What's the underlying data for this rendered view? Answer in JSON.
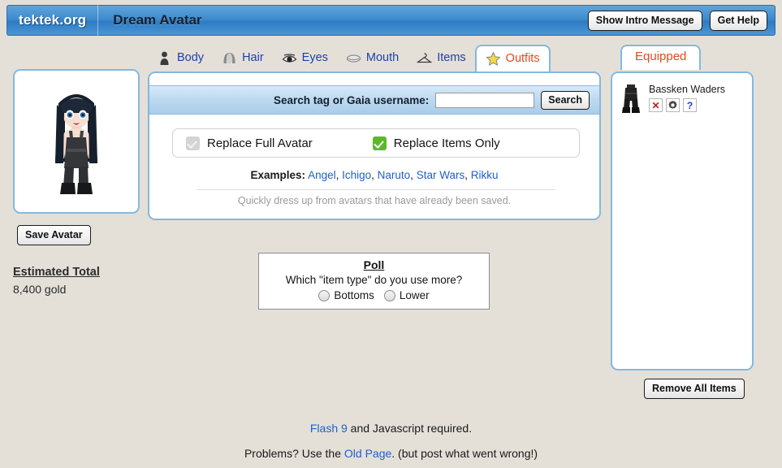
{
  "header": {
    "brand": "tektek.org",
    "title": "Dream Avatar",
    "buttons": [
      {
        "label": "Show Intro Message",
        "name": "show-intro-message-button"
      },
      {
        "label": "Get Help",
        "name": "get-help-button"
      }
    ]
  },
  "left": {
    "save_avatar_label": "Save Avatar",
    "estimated_total_label": "Estimated Total",
    "estimated_total_value": "8,400 gold"
  },
  "tabs": [
    {
      "label": "Body",
      "icon": "person-icon",
      "active": false
    },
    {
      "label": "Hair",
      "icon": "hair-icon",
      "active": false
    },
    {
      "label": "Eyes",
      "icon": "eye-icon",
      "active": false
    },
    {
      "label": "Mouth",
      "icon": "mouth-icon",
      "active": false
    },
    {
      "label": "Items",
      "icon": "hanger-icon",
      "active": false
    },
    {
      "label": "Outfits",
      "icon": "star-icon",
      "active": true
    }
  ],
  "search": {
    "label": "Search tag or Gaia username:",
    "value": "",
    "placeholder": "",
    "button_label": "Search"
  },
  "replace_options": [
    {
      "label": "Replace Full Avatar",
      "checked": false,
      "state": "disabled"
    },
    {
      "label": "Replace Items Only",
      "checked": true,
      "state": "enabled"
    }
  ],
  "examples": {
    "label": "Examples:",
    "links": [
      "Angel",
      "Ichigo",
      "Naruto",
      "Star Wars",
      "Rikku"
    ],
    "hint": "Quickly dress up from avatars that have already been saved."
  },
  "poll": {
    "title": "Poll",
    "question": "Which \"item type\" do you use more?",
    "options": [
      {
        "label": "Bottoms",
        "selected": false
      },
      {
        "label": "Lower",
        "selected": false
      }
    ]
  },
  "equipped": {
    "tab_label": "Equipped",
    "items": [
      {
        "name": "Bassken Waders",
        "actions": [
          {
            "name": "remove-item-button",
            "glyph": "x"
          },
          {
            "name": "gear-icon-button",
            "glyph": "gear"
          },
          {
            "name": "info-item-button",
            "glyph": "?"
          }
        ]
      }
    ],
    "remove_all_label": "Remove All Items"
  },
  "footer": {
    "line1_link": "Flash 9",
    "line1_rest": " and Javascript required.",
    "line2_pre": "Problems? Use the ",
    "line2_link": "Old Page",
    "line2_post": ". (but post what went wrong!)"
  },
  "colors": {
    "header_blue": "#3f8bcd",
    "panel_border": "#84b8e0",
    "active_tab_text": "#e8491d",
    "link_blue": "#1f5fd0",
    "checkbox_green": "#5cb82b",
    "page_bg": "#e4e0d8"
  }
}
